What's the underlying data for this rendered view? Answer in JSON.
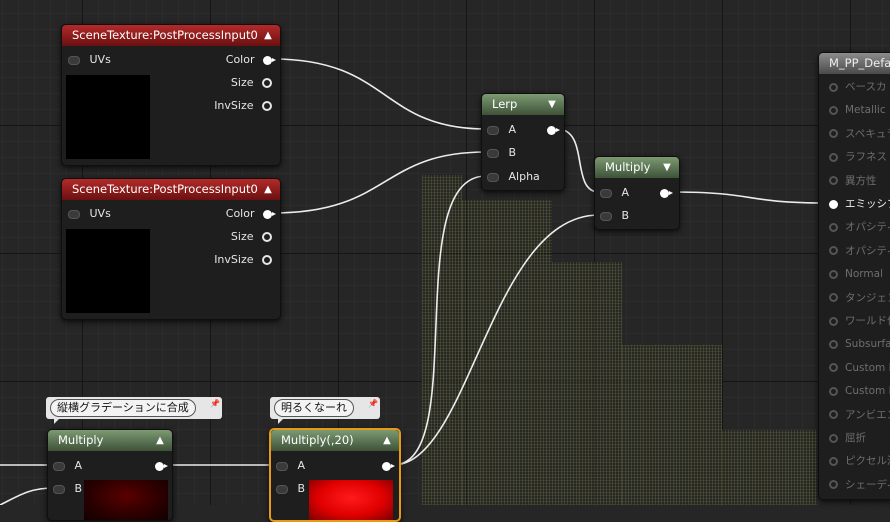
{
  "nodes": {
    "scene_texture_1": {
      "title": "SceneTexture:PostProcessInput0",
      "uvs": "UVs",
      "color": "Color",
      "size": "Size",
      "invsize": "InvSize"
    },
    "scene_texture_2": {
      "title": "SceneTexture:PostProcessInput0",
      "uvs": "UVs",
      "color": "Color",
      "size": "Size",
      "invsize": "InvSize"
    },
    "lerp": {
      "title": "Lerp",
      "a": "A",
      "b": "B",
      "alpha": "Alpha"
    },
    "multiply_main": {
      "title": "Multiply",
      "a": "A",
      "b": "B"
    },
    "multiply_gradient": {
      "title": "Multiply",
      "a": "A",
      "b": "B",
      "comment": "縦横グラデーションに合成"
    },
    "multiply_20": {
      "title": "Multiply(,20)",
      "a": "A",
      "b": "B",
      "comment": "明るくなーれ"
    }
  },
  "material": {
    "title": "M_PP_Defau",
    "pins": [
      "ベースカ",
      "Metallic",
      "スペキュラ",
      "ラフネス",
      "異方性",
      "エミッシブ",
      "オパシティ",
      "オパシティ",
      "Normal",
      "タンジェン",
      "ワールド位",
      "Subsurfac",
      "Custom D",
      "Custom D",
      "アンビエン",
      "屈折",
      "ピクセル深",
      "シェーディ"
    ],
    "active_index": 5
  },
  "colors": {
    "accent_selected": "#e59a18",
    "header_red": "#8b1c1c",
    "header_green": "#5a7250"
  },
  "icons": {
    "collapse": "chevron-up-icon",
    "dropdown": "chevron-down-icon",
    "pin": "pin-icon"
  }
}
